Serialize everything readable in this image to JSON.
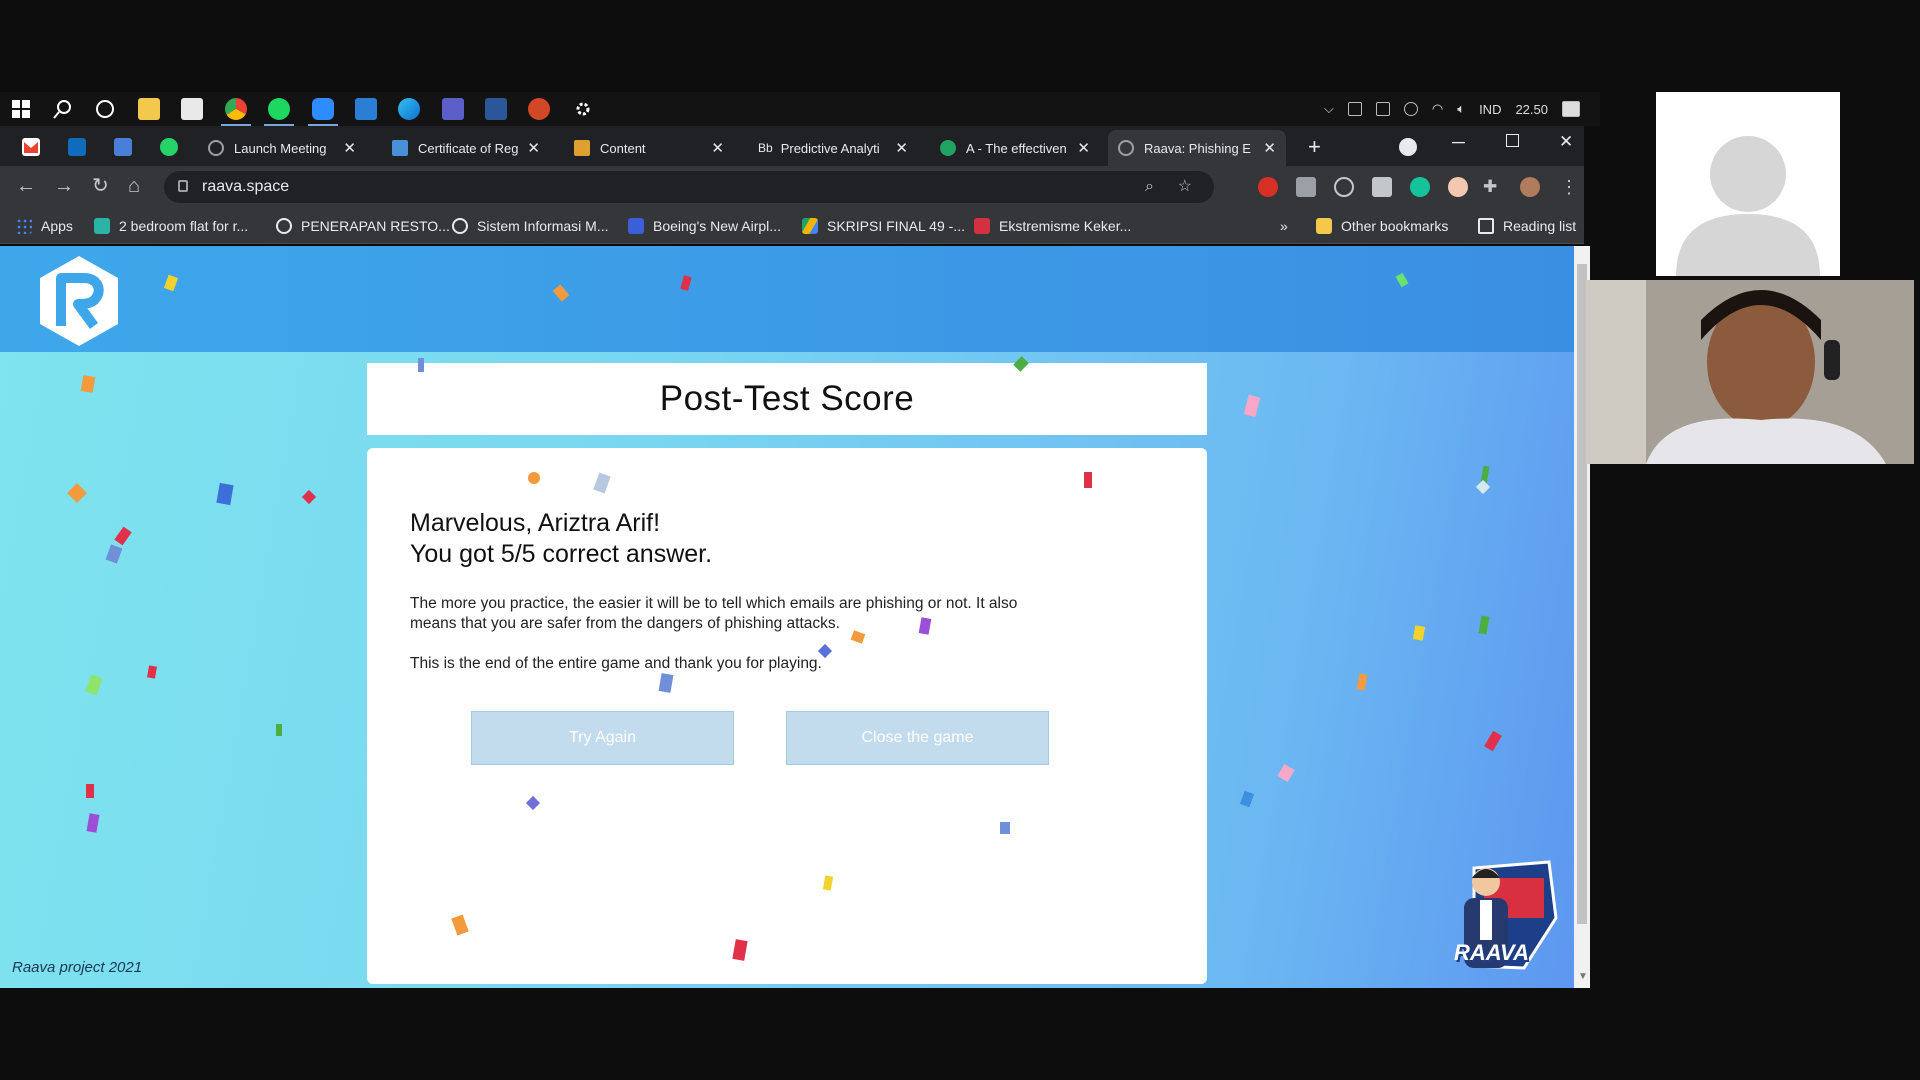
{
  "taskbar": {
    "tray": {
      "language": "IND",
      "time": "22.50"
    },
    "icons": [
      "windows-icon",
      "search-icon",
      "cortana-icon",
      "file-explorer-icon",
      "store-icon",
      "chrome-icon",
      "spotify-icon",
      "zoom-icon",
      "mail-icon",
      "edge-icon",
      "teams-icon",
      "word-icon",
      "powerpoint-icon",
      "settings-icon"
    ]
  },
  "tabs": [
    {
      "title": "Launch Meeting",
      "favicon_color": "#9aa0a6"
    },
    {
      "title": "Certificate of Reg",
      "favicon_color": "#4a90d9"
    },
    {
      "title": "Content",
      "favicon_color": "#e0a030"
    },
    {
      "title": "Predictive Analyti",
      "favicon_label": "Bb"
    },
    {
      "title": "A - The effectiven",
      "favicon_color": "#1fa463"
    },
    {
      "title": "Raava: Phishing E",
      "favicon_color": "#9aa0a6"
    }
  ],
  "address": {
    "url": "raava.space"
  },
  "bookmarks": [
    {
      "label": "Apps",
      "color": "#4285f4"
    },
    {
      "label": "2 bedroom flat for r...",
      "color": "#2ab3a6"
    },
    {
      "label": "PENERAPAN RESTO...",
      "color": "#e8eaed"
    },
    {
      "label": "Sistem Informasi M...",
      "color": "#e8eaed"
    },
    {
      "label": "Boeing's New Airpl...",
      "color": "#3a5fd8"
    },
    {
      "label": "SKRIPSI FINAL 49 -...",
      "color": "#f4b400"
    },
    {
      "label": "Ekstremisme Keker...",
      "color": "#d33040"
    }
  ],
  "bookmarks_right": {
    "more": "»",
    "other": "Other bookmarks",
    "reading": "Reading list"
  },
  "page": {
    "title": "Post-Test Score",
    "heading_line1": "Marvelous, Ariztra Arif!",
    "heading_line2": "You got 5/5 correct answer.",
    "paragraph1": "The more you practice, the easier it will be to tell which emails are phishing or not. It also means that you are safer from the dangers of phishing attacks.",
    "paragraph2": "This is the end of the entire game and thank you for playing.",
    "try_again": "Try Again",
    "close_game": "Close the game",
    "footer": "Raava project 2021",
    "mascot_text": "RAAVA"
  },
  "colors": {
    "header": "#3ea7ea",
    "button": "#c2dcee",
    "background_start": "#7ee4ee",
    "background_end": "#5d97f0"
  }
}
